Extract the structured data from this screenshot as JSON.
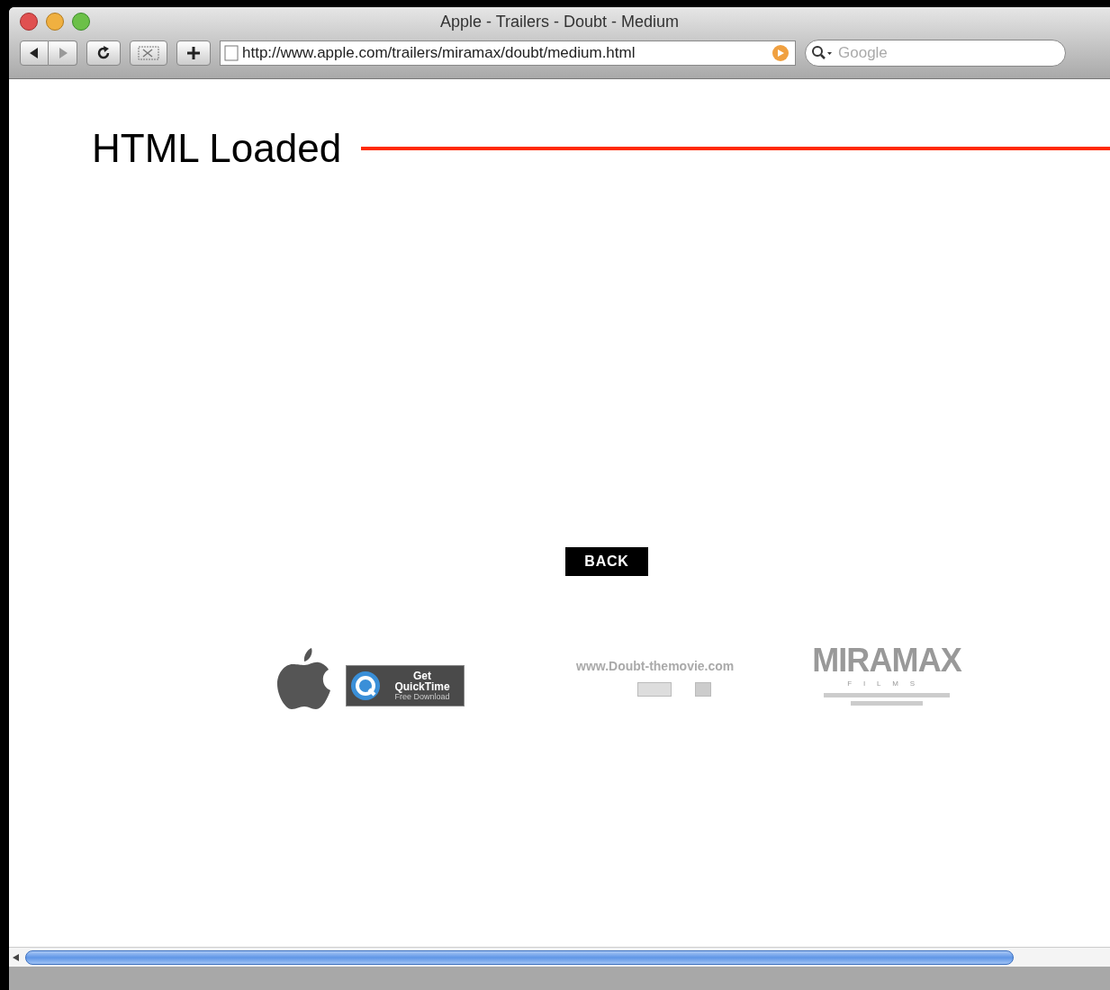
{
  "window": {
    "title": "Apple - Trailers - Doubt - Medium"
  },
  "toolbar": {
    "address": "http://www.apple.com/trailers/miramax/doubt/medium.html",
    "search": {
      "placeholder": "Google"
    }
  },
  "annotation": {
    "label": "HTML Loaded"
  },
  "page": {
    "back_button": "BACK",
    "quicktime_badge": [
      "Get",
      "QuickTime",
      "Free Download"
    ],
    "site_link": "www.Doubt-themovie.com",
    "studio_logo": {
      "name": "MIRAMAX",
      "subtitle": "FILMS"
    }
  }
}
